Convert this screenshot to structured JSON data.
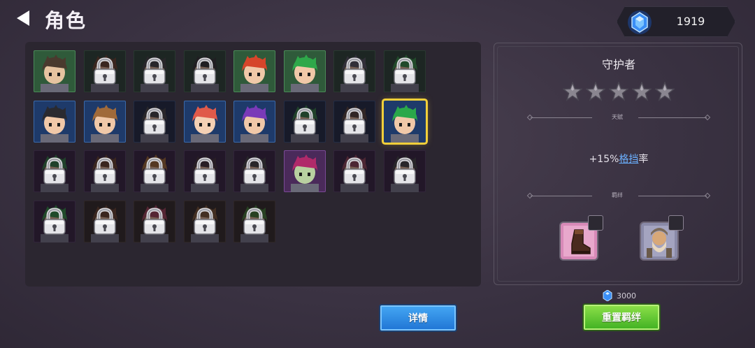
{
  "header": {
    "title": "角色",
    "back_icon": "back-arrow-icon"
  },
  "currency": {
    "icon": "blue-gem-icon",
    "amount": "1919"
  },
  "roster": [
    {
      "bg": "#2f5a3a",
      "border": "#4a8a58",
      "locked": false,
      "hair": "#4a3a2e",
      "skin": "#e6c3a0"
    },
    {
      "bg": "#263a2c",
      "border": "#3a5a42",
      "locked": true,
      "hair": "#5a3a26",
      "skin": "#c89a78"
    },
    {
      "bg": "#263a2c",
      "border": "#3a5a42",
      "locked": true,
      "hair": "#3a3a3a",
      "skin": "#c8a080"
    },
    {
      "bg": "#263a2c",
      "border": "#3a5a42",
      "locked": true,
      "hair": "#2a2a2a",
      "skin": "#c8a080"
    },
    {
      "bg": "#2f5a3a",
      "border": "#4a8a58",
      "locked": false,
      "hair": "#d6452a",
      "skin": "#f0c8a8"
    },
    {
      "bg": "#2f5a3a",
      "border": "#4a8a58",
      "locked": false,
      "hair": "#2ea84a",
      "skin": "#f0c8a8"
    },
    {
      "bg": "#263a2c",
      "border": "#3a5a42",
      "locked": true,
      "hair": "#4a4a52",
      "skin": "#c8a080"
    },
    {
      "bg": "#263a2c",
      "border": "#3a5a42",
      "locked": true,
      "hair": "#2c7a3a",
      "skin": "#c8a080"
    },
    {
      "bg": "#1e3a6a",
      "border": "#3a6aaa",
      "locked": false,
      "hair": "#2a2a30",
      "skin": "#f0c8a8"
    },
    {
      "bg": "#1e3a6a",
      "border": "#3a6aaa",
      "locked": false,
      "hair": "#a06a3a",
      "skin": "#f0c8a8"
    },
    {
      "bg": "#1a2438",
      "border": "#2e4468",
      "locked": true,
      "hair": "#3a3a3a",
      "skin": "#c8a080"
    },
    {
      "bg": "#1e3a6a",
      "border": "#3a6aaa",
      "locked": false,
      "hair": "#e05a4a",
      "skin": "#f4d0b4"
    },
    {
      "bg": "#1e3a6a",
      "border": "#3a6aaa",
      "locked": false,
      "hair": "#7a3ab8",
      "skin": "#f0c8a8"
    },
    {
      "bg": "#1a2438",
      "border": "#2e4468",
      "locked": true,
      "hair": "#2a6a3a",
      "skin": "#c8a080"
    },
    {
      "bg": "#1a2438",
      "border": "#2e4468",
      "locked": true,
      "hair": "#4a3a30",
      "skin": "#c8a080"
    },
    {
      "bg": "#1e3a6a",
      "border": "#3a6aaa",
      "locked": false,
      "hair": "#2aa84a",
      "skin": "#f0c8a8",
      "selected": true
    },
    {
      "bg": "#2e1e36",
      "border": "#4a3656",
      "locked": true,
      "hair": "#2a6a3a",
      "skin": "#c8a080"
    },
    {
      "bg": "#2e1e36",
      "border": "#4a3656",
      "locked": true,
      "hair": "#5a3a26",
      "skin": "#c8a080"
    },
    {
      "bg": "#2e1e36",
      "border": "#4a3656",
      "locked": true,
      "hair": "#8a5a2a",
      "skin": "#c8a080"
    },
    {
      "bg": "#2e1e36",
      "border": "#4a3656",
      "locked": true,
      "hair": "#3a2a30",
      "skin": "#c8a080"
    },
    {
      "bg": "#2e1e36",
      "border": "#4a3656",
      "locked": true,
      "hair": "#3a3a3a",
      "skin": "#c8a080"
    },
    {
      "bg": "#4a2a5a",
      "border": "#7a4a96",
      "locked": false,
      "hair": "#b02a6a",
      "skin": "#b8d0a0"
    },
    {
      "bg": "#2e1e36",
      "border": "#4a3656",
      "locked": true,
      "hair": "#7a3a4a",
      "skin": "#c8a080"
    },
    {
      "bg": "#2e1e36",
      "border": "#4a3656",
      "locked": true,
      "hair": "#3a3a3a",
      "skin": "#c8a080"
    },
    {
      "bg": "#2e1e36",
      "border": "#4a3656",
      "locked": true,
      "hair": "#2a7a3a",
      "skin": "#c8a080"
    },
    {
      "bg": "#2a2420",
      "border": "#443a30",
      "locked": true,
      "hair": "#5a3a26",
      "skin": "#c8a080"
    },
    {
      "bg": "#2a2420",
      "border": "#443a30",
      "locked": true,
      "hair": "#8a3a4a",
      "skin": "#c8a080"
    },
    {
      "bg": "#2a2420",
      "border": "#443a30",
      "locked": true,
      "hair": "#6a4a2a",
      "skin": "#c8a080"
    },
    {
      "bg": "#2a2420",
      "border": "#443a30",
      "locked": true,
      "hair": "#3a6a2a",
      "skin": "#c8a080"
    }
  ],
  "detail": {
    "role_name": "守护者",
    "star_count": 5,
    "stars_filled": 0,
    "talent_label": "天赋",
    "talent_prefix": "+15%",
    "talent_link": "格挡",
    "talent_suffix": "率",
    "bond_label": "羁绊",
    "bond_items": [
      {
        "icon": "boot-item-icon",
        "bg": "#d88ab8",
        "checked": false
      },
      {
        "icon": "dwarf-warrior-portrait-icon",
        "bg": "#8a8aa8",
        "checked": false
      }
    ]
  },
  "reset_cost": {
    "icon": "blue-gem-icon",
    "amount": "3000"
  },
  "buttons": {
    "detail_label": "详情",
    "reset_label": "重置羁绊"
  }
}
